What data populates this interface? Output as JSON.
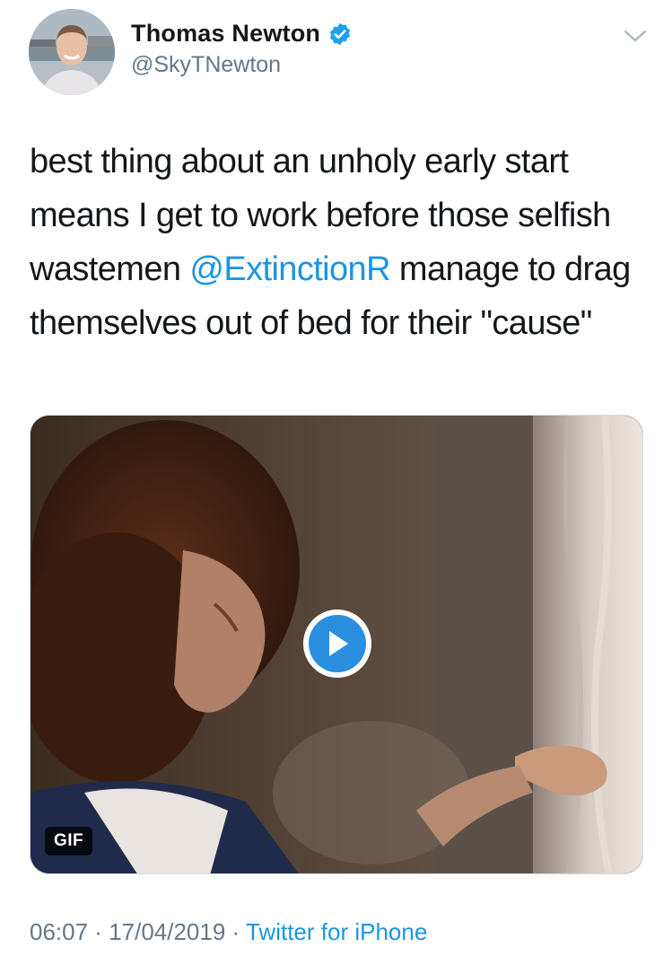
{
  "author": {
    "display_name": "Thomas Newton",
    "handle": "@SkyTNewton",
    "verified": true
  },
  "icons": {
    "verified": "verified-badge-icon",
    "menu": "chevron-down-icon",
    "play": "play-icon"
  },
  "colors": {
    "link": "#1b95e0",
    "secondary_text": "#657786",
    "primary_text": "#14171a",
    "play_button": "#2b8fe0"
  },
  "tweet": {
    "text_before_mention": "best thing about an unholy early start means I get to work before those selfish wastemen ",
    "mention": "@ExtinctionR",
    "text_after_mention": " manage to drag themselves out of bed for their \"cause\""
  },
  "media": {
    "type_badge": "GIF"
  },
  "footer": {
    "time": "06:07",
    "separator1": " · ",
    "date": "17/04/2019",
    "separator2": " · ",
    "source": "Twitter for iPhone"
  }
}
